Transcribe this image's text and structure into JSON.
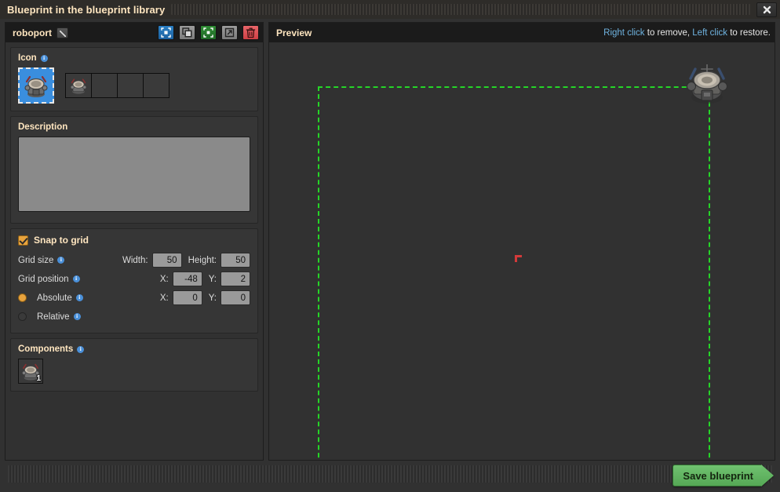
{
  "window": {
    "title": "Blueprint in the blueprint library",
    "close_label": "✕"
  },
  "left_panel": {
    "name": "roboport",
    "edit_icon": "pencil-icon",
    "toolbar": [
      {
        "name": "select-new-contents",
        "icon": "selection-tool-icon",
        "color": "#2a7fc4"
      },
      {
        "name": "copy-blueprint",
        "icon": "copy-icon",
        "color": "#9c9c9c"
      },
      {
        "name": "create-upgrade-planner",
        "icon": "green-selection-icon",
        "color": "#2f8b34"
      },
      {
        "name": "export-to-string",
        "icon": "export-arrow-icon",
        "color": "#9c9c9c"
      },
      {
        "name": "delete-blueprint",
        "icon": "trash-icon",
        "color": "#e9666a"
      }
    ],
    "icon_section": {
      "label": "Icon",
      "selected_icon": "roboport-icon",
      "slots": [
        {
          "item": "roboport-icon",
          "filled": true
        },
        {
          "item": "",
          "filled": false
        },
        {
          "item": "",
          "filled": false
        },
        {
          "item": "",
          "filled": false
        }
      ]
    },
    "description_section": {
      "label": "Description",
      "value": "",
      "placeholder": ""
    },
    "snap_section": {
      "snap_to_grid_label": "Snap to grid",
      "snap_to_grid_checked": true,
      "grid_size_label": "Grid size",
      "grid_size_width_label": "Width:",
      "grid_size_width": "50",
      "grid_size_height_label": "Height:",
      "grid_size_height": "50",
      "grid_position_label": "Grid position",
      "grid_position_x_label": "X:",
      "grid_position_x": "-48",
      "grid_position_y_label": "Y:",
      "grid_position_y": "2",
      "absolute_label": "Absolute",
      "absolute_selected": true,
      "absolute_x_label": "X:",
      "absolute_x": "0",
      "absolute_y_label": "Y:",
      "absolute_y": "0",
      "relative_label": "Relative",
      "relative_selected": false
    },
    "components_section": {
      "label": "Components",
      "items": [
        {
          "item": "roboport-icon",
          "count": "1"
        }
      ]
    }
  },
  "right_panel": {
    "title": "Preview",
    "hint_right": "Right click",
    "hint_mid": " to remove, ",
    "hint_left": "Left click",
    "hint_end": " to restore.",
    "blueprint_bounds_color": "#25d527",
    "origin_marker_color": "#d33a3a",
    "entity": "roboport-entity"
  },
  "footer": {
    "save_label": "Save blueprint",
    "save_color": "#5fb95f"
  }
}
